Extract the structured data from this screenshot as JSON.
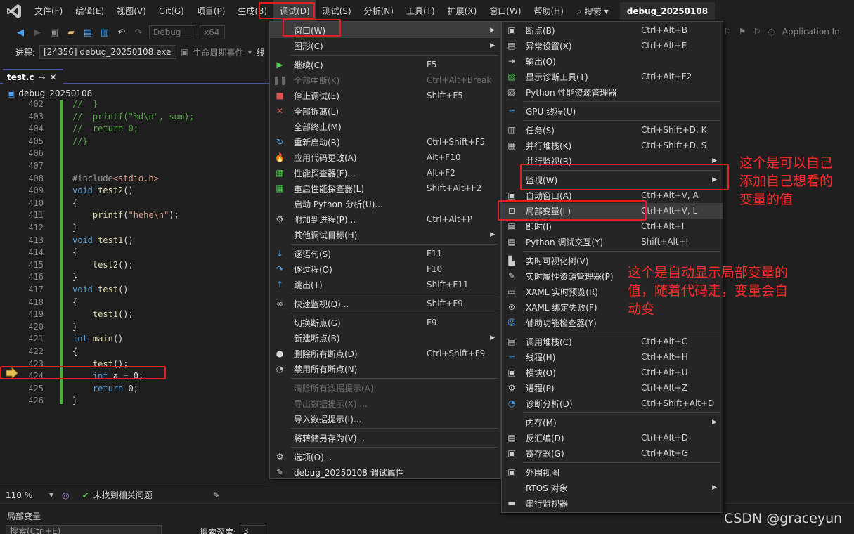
{
  "menubar": {
    "items": [
      "文件(F)",
      "编辑(E)",
      "视图(V)",
      "Git(G)",
      "项目(P)",
      "生成(B)",
      "调试(D)",
      "测试(S)",
      "分析(N)",
      "工具(T)",
      "扩展(X)",
      "窗口(W)",
      "帮助(H)"
    ],
    "search_label": "搜索",
    "solution_title": "debug_20250108"
  },
  "toolbar": {
    "config": "Debug",
    "platform": "x64",
    "process_label": "进程:",
    "process_value": "[24356] debug_20250108.exe",
    "lifecycle_label": "生命周期事件",
    "thread_label": "线",
    "app_insights": "Application In"
  },
  "editor": {
    "tab_label": "test.c",
    "nav_label": "debug_20250108",
    "lines": [
      {
        "n": "402",
        "segs": [
          [
            "c-com",
            "//  }"
          ]
        ]
      },
      {
        "n": "403",
        "segs": [
          [
            "c-com",
            "//  printf(\"%d\\n\", sum);"
          ]
        ]
      },
      {
        "n": "404",
        "segs": [
          [
            "c-com",
            "//  return 0;"
          ]
        ]
      },
      {
        "n": "405",
        "segs": [
          [
            "c-com",
            "//}"
          ]
        ]
      },
      {
        "n": "406",
        "segs": []
      },
      {
        "n": "407",
        "segs": []
      },
      {
        "n": "408",
        "segs": [
          [
            "c-pre",
            "#include"
          ],
          [
            "c-str",
            "<stdio.h>"
          ]
        ]
      },
      {
        "n": "409",
        "segs": [
          [
            "c-kw",
            "void "
          ],
          [
            "c-fn",
            "test2"
          ],
          [
            "",
            "()"
          ]
        ]
      },
      {
        "n": "410",
        "segs": [
          [
            "",
            "{"
          ]
        ]
      },
      {
        "n": "411",
        "segs": [
          [
            "",
            "    "
          ],
          [
            "c-fn",
            "printf"
          ],
          [
            "",
            "("
          ],
          [
            "c-str",
            "\"hehe\\n\""
          ],
          [
            "",
            ");"
          ]
        ]
      },
      {
        "n": "412",
        "segs": [
          [
            "",
            "}"
          ]
        ]
      },
      {
        "n": "413",
        "segs": [
          [
            "c-kw",
            "void "
          ],
          [
            "c-fn",
            "test1"
          ],
          [
            "",
            "()"
          ]
        ]
      },
      {
        "n": "414",
        "segs": [
          [
            "",
            "{"
          ]
        ]
      },
      {
        "n": "415",
        "segs": [
          [
            "",
            "    "
          ],
          [
            "c-fn",
            "test2"
          ],
          [
            "",
            "();"
          ]
        ]
      },
      {
        "n": "416",
        "segs": [
          [
            "",
            "}"
          ]
        ]
      },
      {
        "n": "417",
        "segs": [
          [
            "c-kw",
            "void "
          ],
          [
            "c-fn",
            "test"
          ],
          [
            "",
            "()"
          ]
        ]
      },
      {
        "n": "418",
        "segs": [
          [
            "",
            "{"
          ]
        ]
      },
      {
        "n": "419",
        "segs": [
          [
            "",
            "    "
          ],
          [
            "c-fn",
            "test1"
          ],
          [
            "",
            "();"
          ]
        ]
      },
      {
        "n": "420",
        "segs": [
          [
            "",
            "}"
          ]
        ]
      },
      {
        "n": "421",
        "segs": [
          [
            "c-kw",
            "int "
          ],
          [
            "c-fn",
            "main"
          ],
          [
            "",
            "()"
          ]
        ]
      },
      {
        "n": "422",
        "segs": [
          [
            "",
            "{"
          ]
        ]
      },
      {
        "n": "423",
        "segs": [
          [
            "",
            "    "
          ],
          [
            "c-fn",
            "test"
          ],
          [
            "",
            "();"
          ]
        ]
      },
      {
        "n": "424",
        "segs": [
          [
            "",
            "    "
          ],
          [
            "c-kw",
            "int "
          ],
          [
            "",
            "a = 0;"
          ]
        ]
      },
      {
        "n": "425",
        "segs": [
          [
            "",
            "    "
          ],
          [
            "c-kw",
            "return "
          ],
          [
            "",
            "0;"
          ]
        ]
      },
      {
        "n": "426",
        "segs": [
          [
            "",
            "}"
          ]
        ]
      }
    ]
  },
  "status": {
    "zoom": "110 %",
    "issues": "未找到相关问题"
  },
  "locals_panel": {
    "title": "局部变量",
    "search_placeholder": "搜索(Ctrl+E)",
    "depth_label": "搜索深度:",
    "depth_value": "3"
  },
  "debug_menu": {
    "items": [
      {
        "label": "窗口(W)",
        "shortcut": "",
        "submenu": true,
        "icon": "",
        "disabled": false
      },
      {
        "label": "图形(C)",
        "shortcut": "",
        "submenu": true,
        "icon": "",
        "disabled": false
      },
      {
        "sep": true
      },
      {
        "label": "继续(C)",
        "shortcut": "F5",
        "icon": "play-icon",
        "disabled": false
      },
      {
        "label": "全部中断(K)",
        "shortcut": "Ctrl+Alt+Break",
        "icon": "pause-icon",
        "disabled": true
      },
      {
        "label": "停止调试(E)",
        "shortcut": "Shift+F5",
        "icon": "stop-icon",
        "disabled": false
      },
      {
        "label": "全部拆离(L)",
        "shortcut": "",
        "icon": "detach-icon",
        "disabled": false
      },
      {
        "label": "全部终止(M)",
        "shortcut": "",
        "icon": "",
        "disabled": false
      },
      {
        "label": "重新启动(R)",
        "shortcut": "Ctrl+Shift+F5",
        "icon": "restart-icon",
        "disabled": false
      },
      {
        "label": "应用代码更改(A)",
        "shortcut": "Alt+F10",
        "icon": "hot-reload-icon",
        "disabled": false
      },
      {
        "label": "性能探查器(F)...",
        "shortcut": "Alt+F2",
        "icon": "profiler-icon",
        "disabled": false
      },
      {
        "label": "重启性能探查器(L)",
        "shortcut": "Shift+Alt+F2",
        "icon": "profiler-restart-icon",
        "disabled": false
      },
      {
        "label": "启动 Python 分析(U)...",
        "shortcut": "",
        "icon": "",
        "disabled": false
      },
      {
        "label": "附加到进程(P)...",
        "shortcut": "Ctrl+Alt+P",
        "icon": "attach-icon",
        "disabled": false
      },
      {
        "label": "其他调试目标(H)",
        "shortcut": "",
        "submenu": true,
        "icon": "",
        "disabled": false
      },
      {
        "sep": true
      },
      {
        "label": "逐语句(S)",
        "shortcut": "F11",
        "icon": "step-into-icon",
        "disabled": false
      },
      {
        "label": "逐过程(O)",
        "shortcut": "F10",
        "icon": "step-over-icon",
        "disabled": false
      },
      {
        "label": "跳出(T)",
        "shortcut": "Shift+F11",
        "icon": "step-out-icon",
        "disabled": false
      },
      {
        "sep": true
      },
      {
        "label": "快速监视(Q)...",
        "shortcut": "Shift+F9",
        "icon": "glasses-icon",
        "disabled": false
      },
      {
        "sep": true
      },
      {
        "label": "切换断点(G)",
        "shortcut": "F9",
        "icon": "",
        "disabled": false
      },
      {
        "label": "新建断点(B)",
        "shortcut": "",
        "submenu": true,
        "icon": "",
        "disabled": false
      },
      {
        "label": "删除所有断点(D)",
        "shortcut": "Ctrl+Shift+F9",
        "icon": "delete-breakpoints-icon",
        "disabled": false
      },
      {
        "label": "禁用所有断点(N)",
        "shortcut": "",
        "icon": "disable-breakpoints-icon",
        "disabled": false
      },
      {
        "sep": true
      },
      {
        "label": "清除所有数据提示(A)",
        "shortcut": "",
        "icon": "",
        "disabled": true
      },
      {
        "label": "导出数据提示(X) ...",
        "shortcut": "",
        "icon": "",
        "disabled": true
      },
      {
        "label": "导入数据提示(I)...",
        "shortcut": "",
        "icon": "",
        "disabled": false
      },
      {
        "sep": true
      },
      {
        "label": "将转储另存为(V)...",
        "shortcut": "",
        "icon": "",
        "disabled": false
      },
      {
        "sep": true
      },
      {
        "label": "选项(O)...",
        "shortcut": "",
        "icon": "gear-icon",
        "disabled": false
      },
      {
        "label": "debug_20250108 调试属性",
        "shortcut": "",
        "icon": "wrench-icon",
        "disabled": false
      }
    ]
  },
  "window_submenu": {
    "items": [
      {
        "label": "断点(B)",
        "shortcut": "Ctrl+Alt+B",
        "icon": "breakpoints-window-icon"
      },
      {
        "label": "异常设置(X)",
        "shortcut": "Ctrl+Alt+E",
        "icon": "exception-icon"
      },
      {
        "label": "输出(O)",
        "shortcut": "",
        "icon": "output-icon"
      },
      {
        "label": "显示诊断工具(T)",
        "shortcut": "Ctrl+Alt+F2",
        "icon": "diagnostics-icon"
      },
      {
        "label": "Python 性能资源管理器",
        "shortcut": "",
        "icon": "python-perf-icon"
      },
      {
        "sep": true
      },
      {
        "label": "GPU 线程(U)",
        "shortcut": "",
        "icon": "gpu-thread-icon"
      },
      {
        "sep": true
      },
      {
        "label": "任务(S)",
        "shortcut": "Ctrl+Shift+D, K",
        "icon": "tasks-icon"
      },
      {
        "label": "并行堆栈(K)",
        "shortcut": "Ctrl+Shift+D, S",
        "icon": "parallel-stacks-icon"
      },
      {
        "label": "并行监视(R)",
        "shortcut": "",
        "icon": "",
        "submenu": true
      },
      {
        "sep": true
      },
      {
        "label": "监视(W)",
        "shortcut": "",
        "icon": "",
        "submenu": true
      },
      {
        "label": "自动窗口(A)",
        "shortcut": "Ctrl+Alt+V, A",
        "icon": "autos-icon"
      },
      {
        "label": "局部变量(L)",
        "shortcut": "Ctrl+Alt+V, L",
        "icon": "locals-icon",
        "highlight": true
      },
      {
        "label": "即时(I)",
        "shortcut": "Ctrl+Alt+I",
        "icon": "immediate-icon"
      },
      {
        "label": "Python 调试交互(Y)",
        "shortcut": "Shift+Alt+I",
        "icon": "python-interactive-icon"
      },
      {
        "sep": true
      },
      {
        "label": "实时可视化树(V)",
        "shortcut": "",
        "icon": "visual-tree-icon"
      },
      {
        "label": "实时属性资源管理器(P)",
        "shortcut": "",
        "icon": "property-explorer-icon"
      },
      {
        "label": "XAML 实时预览(R)",
        "shortcut": "",
        "icon": "xaml-preview-icon"
      },
      {
        "label": "XAML 绑定失败(F)",
        "shortcut": "",
        "icon": "xaml-binding-icon"
      },
      {
        "label": "辅助功能检查器(Y)",
        "shortcut": "",
        "icon": "accessibility-icon"
      },
      {
        "sep": true
      },
      {
        "label": "调用堆栈(C)",
        "shortcut": "Ctrl+Alt+C",
        "icon": "call-stack-icon"
      },
      {
        "label": "线程(H)",
        "shortcut": "Ctrl+Alt+H",
        "icon": "threads-icon"
      },
      {
        "label": "模块(O)",
        "shortcut": "Ctrl+Alt+U",
        "icon": "modules-icon"
      },
      {
        "label": "进程(P)",
        "shortcut": "Ctrl+Alt+Z",
        "icon": "processes-icon"
      },
      {
        "label": "诊断分析(D)",
        "shortcut": "Ctrl+Shift+Alt+D",
        "icon": "diagnostic-analysis-icon"
      },
      {
        "sep": true
      },
      {
        "label": "内存(M)",
        "shortcut": "",
        "icon": "",
        "submenu": true
      },
      {
        "label": "反汇编(D)",
        "shortcut": "Ctrl+Alt+D",
        "icon": "disassembly-icon"
      },
      {
        "label": "寄存器(G)",
        "shortcut": "Ctrl+Alt+G",
        "icon": "registers-icon"
      },
      {
        "sep": true
      },
      {
        "label": "外围视图",
        "shortcut": "",
        "icon": "peripheral-icon"
      },
      {
        "label": "RTOS 对象",
        "shortcut": "",
        "icon": "",
        "submenu": true
      },
      {
        "label": "串行监视器",
        "shortcut": "",
        "icon": "serial-monitor-icon"
      }
    ]
  },
  "annotations": {
    "watch_note": [
      "这个是可以自己",
      "添加自己想看的",
      "变量的值"
    ],
    "locals_note": [
      "这个是自动显示局部变量的",
      "值，随着代码走，变量会自",
      "动变"
    ]
  },
  "watermark": "CSDN @graceyun",
  "colors": {
    "accent": "#4e52a8",
    "annotation": "#e02020",
    "code_green": "#57a64a"
  }
}
